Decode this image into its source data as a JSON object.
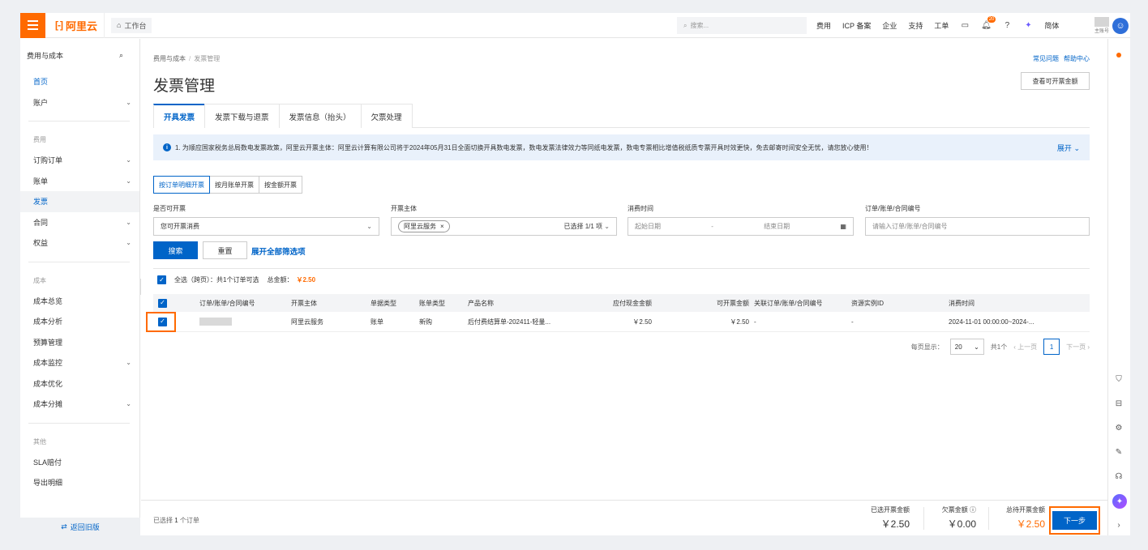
{
  "topbar": {
    "logo_text": "阿里云",
    "workbench": "工作台",
    "search_placeholder": "搜索...",
    "nav": [
      "费用",
      "ICP 备案",
      "企业",
      "支持",
      "工单"
    ],
    "bell_badge": "20",
    "lang": "简体",
    "account_sub": "主账号"
  },
  "sidebar": {
    "title": "费用与成本",
    "top_items": [
      {
        "label": "首页"
      },
      {
        "label": "账户"
      }
    ],
    "groups": [
      {
        "title": "费用",
        "items": [
          {
            "label": "订购订单"
          },
          {
            "label": "账单"
          },
          {
            "label": "发票"
          },
          {
            "label": "合同"
          },
          {
            "label": "权益"
          }
        ]
      },
      {
        "title": "成本",
        "items": [
          {
            "label": "成本总览"
          },
          {
            "label": "成本分析"
          },
          {
            "label": "预算管理"
          },
          {
            "label": "成本监控"
          },
          {
            "label": "成本优化"
          },
          {
            "label": "成本分摊"
          }
        ]
      },
      {
        "title": "其他",
        "items": [
          {
            "label": "SLA赔付"
          },
          {
            "label": "导出明细"
          }
        ]
      }
    ],
    "footer": "返回旧版"
  },
  "main": {
    "breadcrumb": [
      "费用与成本",
      "发票管理"
    ],
    "help_links": [
      "常见问题",
      "帮助中心"
    ],
    "title": "发票管理",
    "view_amount_btn": "查看可开票金额",
    "tabs": [
      "开具发票",
      "发票下载与退票",
      "发票信息（抬头）",
      "欠票处理"
    ],
    "notice": "1. 为顺应国家税务总局数电发票政策，阿里云开票主体：阿里云计算有限公司将于2024年05月31日全面切换开具数电发票，数电发票法律效力等同纸电发票，数电专票相比增值税纸质专票开具时效更快，免去邮寄时间安全无忧，请您放心使用！",
    "notice_expand": "展开",
    "modes": [
      "按订单明细开票",
      "按月账单开票",
      "按金额开票"
    ],
    "filters": {
      "can_invoice_label": "是否可开票",
      "can_invoice_value": "您可开票消费",
      "entity_label": "开票主体",
      "entity_tag": "阿里云服务",
      "entity_count": "已选择 1/1 项",
      "time_label": "消费时间",
      "start_placeholder": "起始日期",
      "end_placeholder": "结束日期",
      "order_label": "订单/账单/合同编号",
      "order_placeholder": "请输入订单/账单/合同编号"
    },
    "search_btn": "搜索",
    "reset_btn": "重置",
    "expand_filters": "展开全部筛选项",
    "select_all_text": "全选（跨页）：共1个订单可选",
    "total_label": "总金额：",
    "total_value": "￥2.50",
    "table": {
      "headers": [
        "订单/账单/合同编号",
        "开票主体",
        "单据类型",
        "账单类型",
        "产品名称",
        "应付现金金额",
        "可开票金额",
        "关联订单/账单/合同编号",
        "资源实例ID",
        "消费时间"
      ],
      "rows": [
        {
          "entity": "阿里云服务",
          "doc_type": "账单",
          "bill_type": "新购",
          "product": "后付费结算单-202411-轻量...",
          "payable": "￥2.50",
          "invoiceable": "￥2.50",
          "related": "-",
          "resource": "-",
          "time": "2024-11-01 00:00:00~2024-..."
        }
      ]
    },
    "pager": {
      "page_size_label": "每页显示：",
      "page_size": "20",
      "total": "共1个",
      "prev": "上一页",
      "page": "1",
      "next": "下一页"
    },
    "footer": {
      "selected_prefix": "已选择",
      "selected_count": "1",
      "selected_suffix": "个订单",
      "sel_amount_label": "已选开票金额",
      "sel_amount": "￥2.50",
      "owed_label": "欠票金额",
      "owed": "￥0.00",
      "pending_label": "总待开票金额",
      "pending": "￥2.50",
      "next_btn": "下一步"
    }
  }
}
